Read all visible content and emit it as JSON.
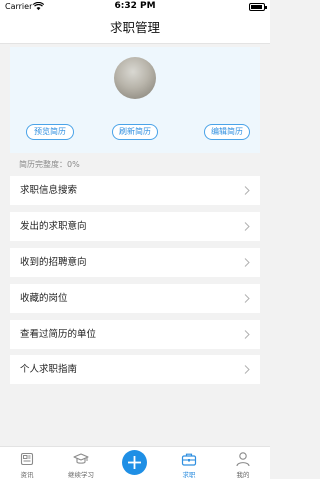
{
  "status_bar": {
    "carrier": "Carrier",
    "time": "6:32 PM"
  },
  "nav": {
    "title": "求职管理"
  },
  "profile": {
    "buttons": {
      "preview": "预览简历",
      "refresh": "刷新简历",
      "edit": "编辑简历"
    },
    "completeness": "简历完整度：0%"
  },
  "menu": [
    {
      "label": "求职信息搜索"
    },
    {
      "label": "发出的求职意向"
    },
    {
      "label": "收到的招聘意向"
    },
    {
      "label": "收藏的岗位"
    },
    {
      "label": "查看过简历的单位"
    },
    {
      "label": "个人求职指南"
    }
  ],
  "tabs": [
    {
      "label": "资讯"
    },
    {
      "label": "继续学习"
    },
    {
      "label": "求职",
      "active": true
    },
    {
      "label": "我的"
    }
  ],
  "colors": {
    "accent": "#2f8fe0",
    "card_bg": "#eef7fd",
    "page_bg": "#f2f2f2"
  }
}
